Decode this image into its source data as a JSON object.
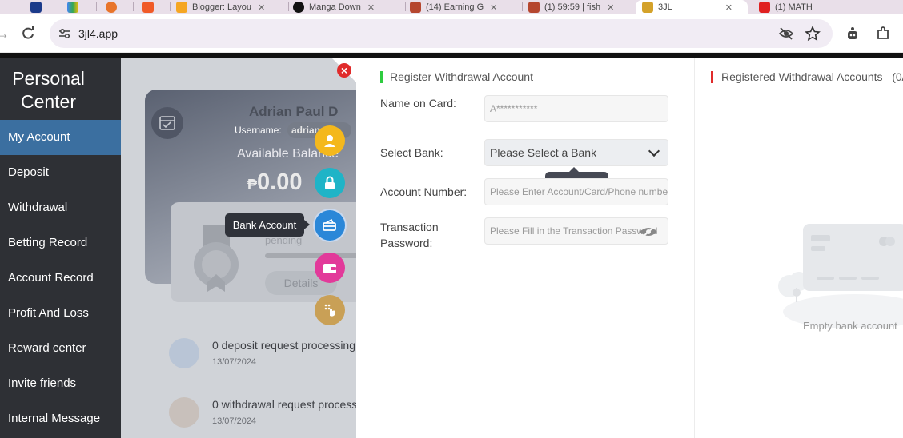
{
  "browser": {
    "tabs": [
      {
        "title": "",
        "icon": "tab-favicon"
      },
      {
        "title": "",
        "icon": "tab-favicon"
      },
      {
        "title": "",
        "icon": "tab-favicon"
      },
      {
        "title": "",
        "icon": "tab-favicon"
      },
      {
        "title": "Blogger: Layou",
        "icon": "blogger-icon"
      },
      {
        "title": "Manga Down",
        "icon": "tab-favicon"
      },
      {
        "title": "(14) Earning G",
        "icon": "tab-favicon"
      },
      {
        "title": "(1) 59:59 | fish",
        "icon": "tab-favicon"
      },
      {
        "title": "3JL",
        "icon": "tab-favicon"
      },
      {
        "title": "(1) MATH",
        "icon": "youtube-icon"
      }
    ],
    "url": "3jl4.app"
  },
  "sidebar": {
    "title_line1": "Personal",
    "title_line2": "Center",
    "items": [
      {
        "label": "My Account"
      },
      {
        "label": "Deposit"
      },
      {
        "label": "Withdrawal"
      },
      {
        "label": "Betting Record"
      },
      {
        "label": "Account Record"
      },
      {
        "label": "Profit And Loss"
      },
      {
        "label": "Reward center"
      },
      {
        "label": "Invite friends"
      },
      {
        "label": "Internal Message"
      }
    ]
  },
  "account": {
    "name": "Adrian Paul D",
    "username_label": "Username:",
    "username_value": "adrian",
    "available_balance_label": "Available Balance",
    "currency": "₱",
    "balance": "0.00",
    "vip_status": "pending",
    "details_button": "Details"
  },
  "records": [
    {
      "text": "0 deposit request processing",
      "date": "13/07/2024"
    },
    {
      "text": "0 withdrawal request process",
      "date": "13/07/2024"
    }
  ],
  "float_menu": {
    "tooltip": "Bank Account"
  },
  "register_form": {
    "title": "Register Withdrawal Account",
    "name_label": "Name on Card:",
    "name_value": "A***********",
    "bank_label": "Select Bank:",
    "bank_value": "Please Select a Bank",
    "account_label": "Account Number:",
    "account_placeholder": "Please Enter Account/Card/Phone number",
    "password_label_line1": "Transaction",
    "password_label_line2": "Password:",
    "password_placeholder": "Please Fill in the Transaction Password"
  },
  "registered": {
    "title": "Registered Withdrawal Accounts",
    "count": "(0/",
    "empty_text": "Empty bank account"
  },
  "colors": {
    "sidebar_bg": "#2e3035",
    "sidebar_active": "#3b6fa0",
    "accent_green": "#2ecc40",
    "accent_red": "#e02b2b"
  }
}
